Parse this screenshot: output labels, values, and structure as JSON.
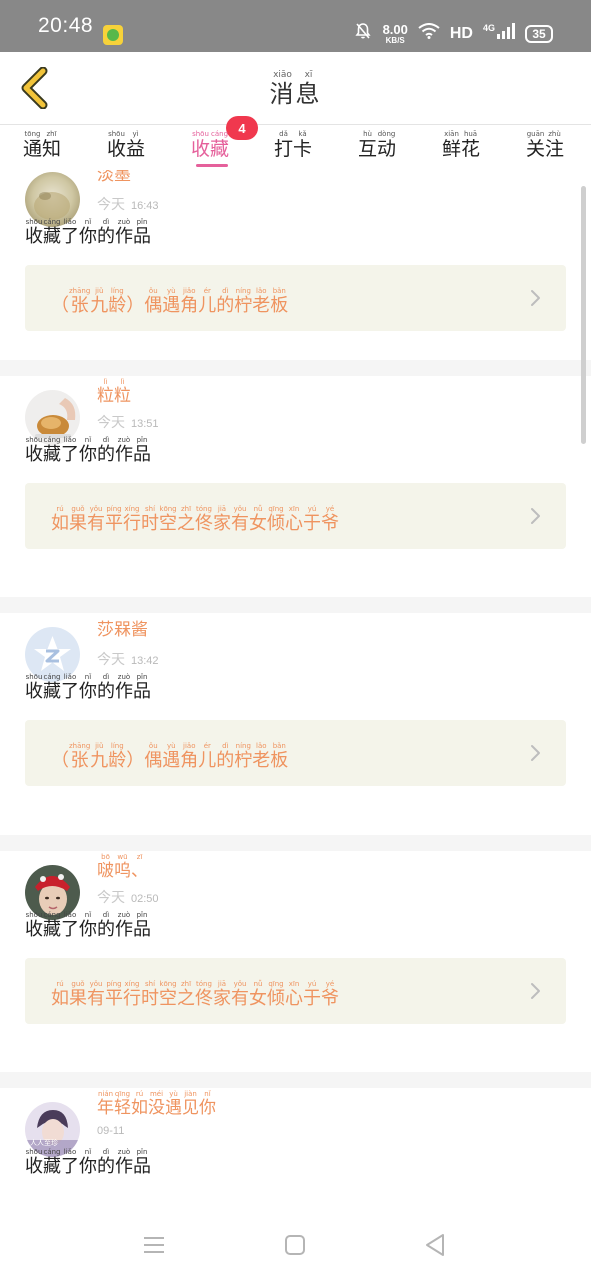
{
  "status_bar": {
    "time": "20:48",
    "app_icon": "leaf-app-icon",
    "icons": [
      "bell-muted-icon",
      "wifi-icon",
      "signal-icon",
      "battery-icon"
    ],
    "net_speed_value": "8.00",
    "net_speed_unit": "KB/S",
    "hd_label": "HD",
    "network_label": "4G",
    "battery": "35"
  },
  "header": {
    "back_icon": "chevron-left-icon",
    "title_chars": [
      {
        "c": "消",
        "p": "xiāo"
      },
      {
        "c": "息",
        "p": "xī"
      }
    ]
  },
  "tabs": [
    {
      "chars": [
        {
          "c": "通",
          "p": "tōng"
        },
        {
          "c": "知",
          "p": "zhī"
        }
      ]
    },
    {
      "chars": [
        {
          "c": "收",
          "p": "shōu"
        },
        {
          "c": "益",
          "p": "yì"
        }
      ]
    },
    {
      "chars": [
        {
          "c": "收",
          "p": "shōu"
        },
        {
          "c": "藏",
          "p": "cáng"
        }
      ],
      "active": true,
      "badge": "4"
    },
    {
      "chars": [
        {
          "c": "打",
          "p": "dǎ"
        },
        {
          "c": "卡",
          "p": "kǎ"
        }
      ]
    },
    {
      "chars": [
        {
          "c": "互",
          "p": "hù"
        },
        {
          "c": "动",
          "p": "dòng"
        }
      ]
    },
    {
      "chars": [
        {
          "c": "鲜",
          "p": "xiān"
        },
        {
          "c": "花",
          "p": "huā"
        }
      ]
    },
    {
      "chars": [
        {
          "c": "关",
          "p": "guān"
        },
        {
          "c": "注",
          "p": "zhù"
        }
      ]
    }
  ],
  "action_chars": [
    {
      "c": "收",
      "p": "shōu"
    },
    {
      "c": "藏",
      "p": "cáng"
    },
    {
      "c": "了",
      "p": "liǎo"
    },
    {
      "c": "你",
      "p": "nǐ"
    },
    {
      "c": "的",
      "p": "dì"
    },
    {
      "c": "作",
      "p": "zuò"
    },
    {
      "c": "品",
      "p": "pǐn"
    }
  ],
  "notifications": [
    {
      "avatar": "cat-avatar",
      "username": [
        {
          "c": "淡",
          "p": ""
        },
        {
          "c": "墨",
          "p": ""
        }
      ],
      "day": "今天",
      "time": "16:43",
      "work": [
        {
          "c": "（",
          "p": ""
        },
        {
          "c": "张",
          "p": "zhāng"
        },
        {
          "c": "九",
          "p": "jiǔ"
        },
        {
          "c": "龄",
          "p": "líng"
        },
        {
          "c": "）",
          "p": ""
        },
        {
          "c": "偶",
          "p": "ǒu"
        },
        {
          "c": "遇",
          "p": "yù"
        },
        {
          "c": "角",
          "p": "jiǎo"
        },
        {
          "c": "儿",
          "p": "ér"
        },
        {
          "c": "的",
          "p": "dì"
        },
        {
          "c": "柠",
          "p": "níng"
        },
        {
          "c": "老",
          "p": "lǎo"
        },
        {
          "c": "板",
          "p": "bǎn"
        }
      ]
    },
    {
      "avatar": "bread-avatar",
      "username": [
        {
          "c": "粒",
          "p": "lì"
        },
        {
          "c": "粒",
          "p": "lì"
        }
      ],
      "day": "今天",
      "time": "13:51",
      "work": [
        {
          "c": "如",
          "p": "rú"
        },
        {
          "c": "果",
          "p": "guǒ"
        },
        {
          "c": "有",
          "p": "yǒu"
        },
        {
          "c": "平",
          "p": "píng"
        },
        {
          "c": "行",
          "p": "xíng"
        },
        {
          "c": "时",
          "p": "shí"
        },
        {
          "c": "空",
          "p": "kōng"
        },
        {
          "c": "之",
          "p": "zhī"
        },
        {
          "c": "佟",
          "p": "tóng"
        },
        {
          "c": "家",
          "p": "jiā"
        },
        {
          "c": "有",
          "p": "yǒu"
        },
        {
          "c": "女",
          "p": "nǚ"
        },
        {
          "c": "倾",
          "p": "qīng"
        },
        {
          "c": "心",
          "p": "xīn"
        },
        {
          "c": "于",
          "p": "yú"
        },
        {
          "c": "爷",
          "p": "yé"
        }
      ]
    },
    {
      "avatar": "default-z-avatar",
      "username": [
        {
          "c": "莎",
          "p": ""
        },
        {
          "c": "槑",
          "p": ""
        },
        {
          "c": "酱",
          "p": ""
        }
      ],
      "day": "今天",
      "time": "13:42",
      "work": [
        {
          "c": "（",
          "p": ""
        },
        {
          "c": "张",
          "p": "zhāng"
        },
        {
          "c": "九",
          "p": "jiǔ"
        },
        {
          "c": "龄",
          "p": "líng"
        },
        {
          "c": "）",
          "p": ""
        },
        {
          "c": "偶",
          "p": "ǒu"
        },
        {
          "c": "遇",
          "p": "yù"
        },
        {
          "c": "角",
          "p": "jiǎo"
        },
        {
          "c": "儿",
          "p": "ér"
        },
        {
          "c": "的",
          "p": "dì"
        },
        {
          "c": "柠",
          "p": "níng"
        },
        {
          "c": "老",
          "p": "lǎo"
        },
        {
          "c": "板",
          "p": "bǎn"
        }
      ]
    },
    {
      "avatar": "red-hat-avatar",
      "username": [
        {
          "c": "啵",
          "p": "bō"
        },
        {
          "c": "呜",
          "p": "wū"
        },
        {
          "c": "、",
          "p": "zī"
        }
      ],
      "day": "今天",
      "time": "02:50",
      "work": [
        {
          "c": "如",
          "p": "rú"
        },
        {
          "c": "果",
          "p": "guǒ"
        },
        {
          "c": "有",
          "p": "yǒu"
        },
        {
          "c": "平",
          "p": "píng"
        },
        {
          "c": "行",
          "p": "xíng"
        },
        {
          "c": "时",
          "p": "shí"
        },
        {
          "c": "空",
          "p": "kōng"
        },
        {
          "c": "之",
          "p": "zhī"
        },
        {
          "c": "佟",
          "p": "tóng"
        },
        {
          "c": "家",
          "p": "jiā"
        },
        {
          "c": "有",
          "p": "yǒu"
        },
        {
          "c": "女",
          "p": "nǚ"
        },
        {
          "c": "倾",
          "p": "qīng"
        },
        {
          "c": "心",
          "p": "xīn"
        },
        {
          "c": "于",
          "p": "yú"
        },
        {
          "c": "爷",
          "p": "yé"
        }
      ]
    },
    {
      "avatar": "portrait-avatar",
      "username": [
        {
          "c": "年",
          "p": "nián"
        },
        {
          "c": "轻",
          "p": "qīng"
        },
        {
          "c": "如",
          "p": "rú"
        },
        {
          "c": "没",
          "p": "méi"
        },
        {
          "c": "遇",
          "p": "yù"
        },
        {
          "c": "见",
          "p": "jiàn"
        },
        {
          "c": "你",
          "p": "nǐ"
        }
      ],
      "day": "",
      "time": "09-11",
      "avatar_caption": "人人至珍",
      "work": []
    }
  ],
  "nav_bar": {
    "icons": [
      "menu-icon",
      "home-square-icon",
      "back-triangle-icon"
    ]
  }
}
